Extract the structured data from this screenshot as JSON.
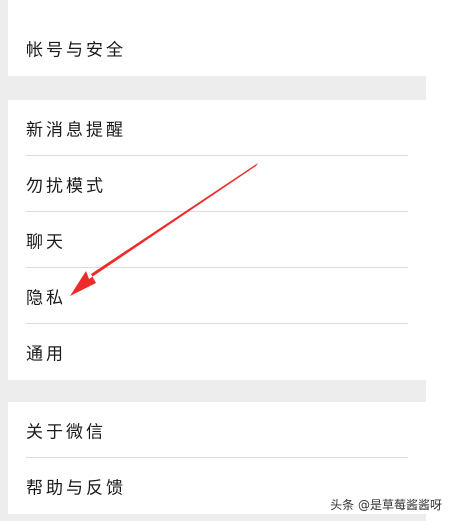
{
  "settings": {
    "groups": [
      {
        "items": [
          {
            "label": "帐号与安全"
          }
        ]
      },
      {
        "items": [
          {
            "label": "新消息提醒"
          },
          {
            "label": "勿扰模式"
          },
          {
            "label": "聊天"
          },
          {
            "label": "隐私"
          },
          {
            "label": "通用"
          }
        ]
      },
      {
        "items": [
          {
            "label": "关于微信"
          },
          {
            "label": "帮助与反馈"
          }
        ]
      }
    ]
  },
  "annotation": {
    "color": "#ee2a2a",
    "points_to": "隐私"
  },
  "watermark": "头条 @是草莓酱酱呀"
}
